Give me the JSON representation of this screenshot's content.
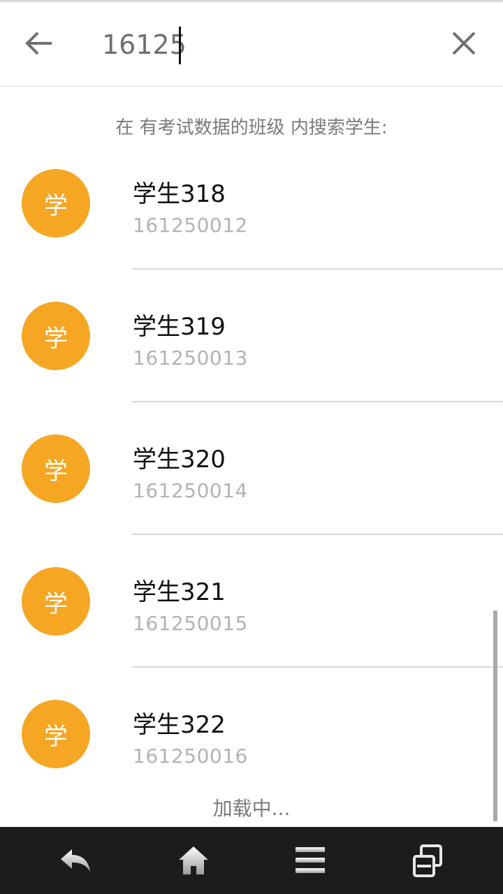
{
  "search": {
    "value": "16125",
    "placeholder": ""
  },
  "hint_text": "在 有考试数据的班级 内搜索学生:",
  "students": [
    {
      "avatar": "学",
      "name": "学生318",
      "id": "161250012"
    },
    {
      "avatar": "学",
      "name": "学生319",
      "id": "161250013"
    },
    {
      "avatar": "学",
      "name": "学生320",
      "id": "161250014"
    },
    {
      "avatar": "学",
      "name": "学生321",
      "id": "161250015"
    },
    {
      "avatar": "学",
      "name": "学生322",
      "id": "161250016"
    }
  ],
  "loading_text": "加载中...",
  "colors": {
    "avatar_bg": "#f5a623",
    "navbar_bg": "#1c1c1c"
  },
  "icons": {
    "back": "arrow-left-icon",
    "close": "close-icon",
    "nav_back": "nav-back-icon",
    "nav_home": "nav-home-icon",
    "nav_menu": "nav-menu-icon",
    "nav_recent": "nav-recent-icon"
  }
}
